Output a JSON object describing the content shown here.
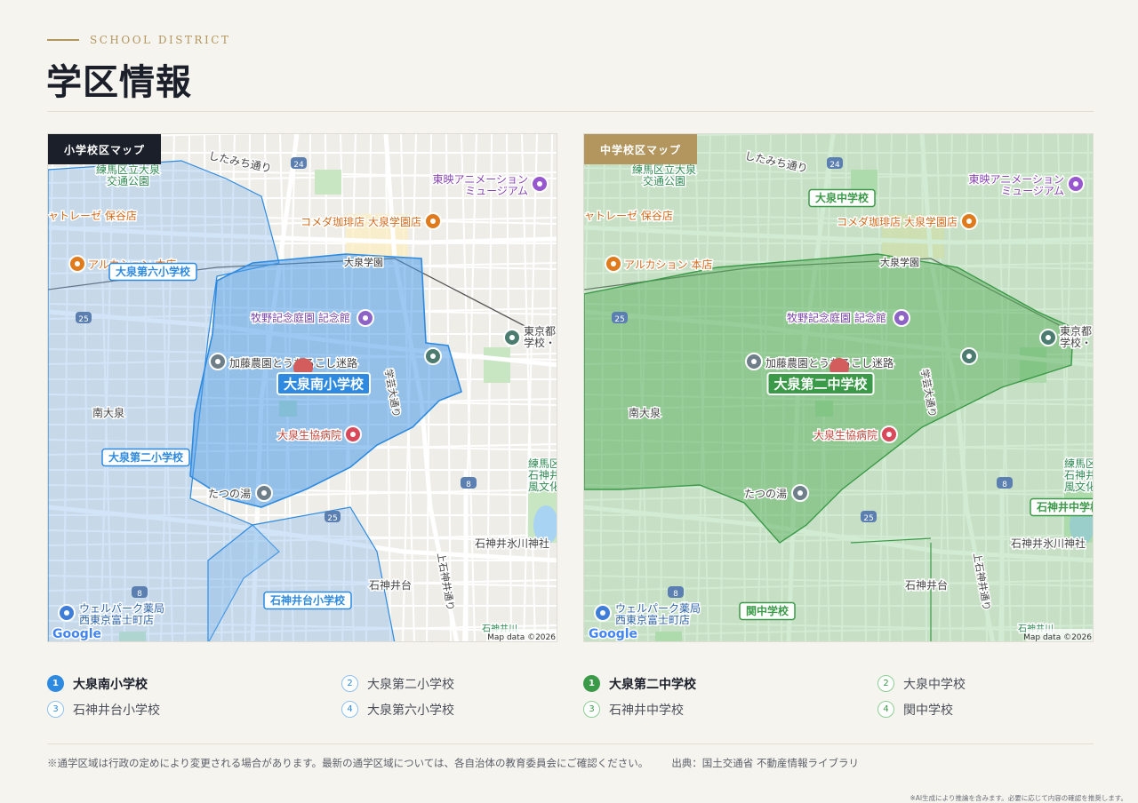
{
  "header": {
    "eyebrow": "SCHOOL DISTRICT",
    "title": "学区情報"
  },
  "maps": [
    {
      "tag": "小学校区マップ",
      "tag_color": "#1b1f2a",
      "accent": "#2d8ae0",
      "school_labels": [
        "大泉南小学校",
        "大泉第六小学校",
        "大泉第二小学校",
        "石神井台小学校"
      ],
      "legend": [
        {
          "num": "1",
          "name": "大泉南小学校"
        },
        {
          "num": "2",
          "name": "大泉第二小学校"
        },
        {
          "num": "3",
          "name": "石神井台小学校"
        },
        {
          "num": "4",
          "name": "大泉第六小学校"
        }
      ]
    },
    {
      "tag": "中学校区マップ",
      "tag_color": "#b3955e",
      "accent": "#3a9a48",
      "school_labels": [
        "大泉第二中学校",
        "大泉中学校",
        "石神井中学校",
        "関中学校"
      ],
      "legend": [
        {
          "num": "1",
          "name": "大泉第二中学校"
        },
        {
          "num": "2",
          "name": "大泉中学校"
        },
        {
          "num": "3",
          "name": "石神井中学校"
        },
        {
          "num": "4",
          "name": "関中学校"
        }
      ]
    }
  ],
  "map_text": {
    "road1": "したみち通り",
    "route24": "24",
    "route25": "25",
    "route8": "8",
    "park": "練馬区立大泉\n交通公園",
    "toei": "東映アニメーション\nミュージアム",
    "komeda": "コメダ珈琲店 大泉学園店",
    "yatre": "ャトレーゼ 保谷店",
    "alcashion": "アルカション 本店",
    "oizumigakuen": "大泉学園",
    "makino": "牧野記念庭園 記念館",
    "kato": "加藤農園とうもろこし迷路",
    "gakugei": "学芸大通り",
    "minami": "南大泉",
    "seikyo": "大泉生協病院",
    "tatsuno": "たつの湯",
    "toukyo": "東京都\n学校・",
    "nerima_park": "練馬区立\n石神井松の\n風文化公園",
    "hikawa": "石神井氷川神社",
    "shakujiidai": "石神井台",
    "kamishakujii": "上石神井通り",
    "welpark": "ウェルパーク薬局\n西東京富士町店",
    "shakujiigawa": "石神井川",
    "mapdata": "Map data ©2026",
    "google": "Google"
  },
  "footer": {
    "note": "※通学区域は行政の定めにより変更される場合があります。最新の通学区域については、各自治体の教育委員会にご確認ください。",
    "source": "出典：国土交通省 不動産情報ライブラリ",
    "ai_note": "※AI生成により推論を含みます。必要に応じて内容の確認を推奨します。"
  }
}
